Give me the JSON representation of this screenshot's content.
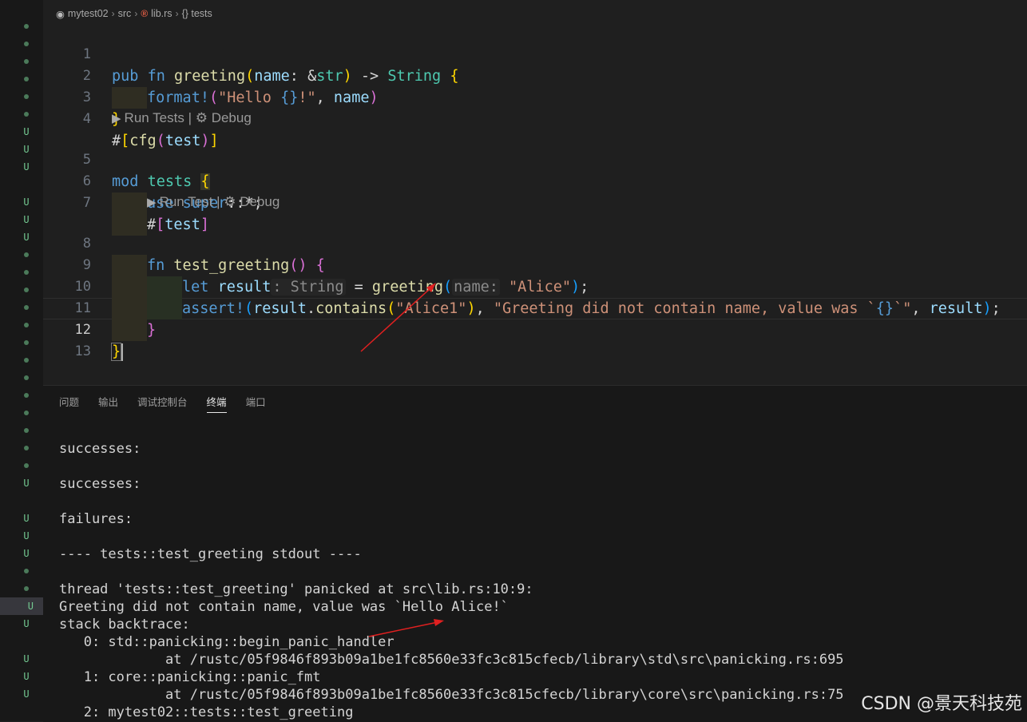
{
  "breadcrumb": {
    "project": "mytest02",
    "folder": "src",
    "file": "lib.rs",
    "symbol": "{} tests"
  },
  "code_lines": {
    "n1": "1",
    "n2": "2",
    "n3": "3",
    "n4": "4",
    "n5": "5",
    "n6": "6",
    "n7": "7",
    "n8": "8",
    "n9": "9",
    "n10": "10",
    "n11": "11",
    "n12": "12",
    "n13": "13"
  },
  "code_lens": {
    "run_tests": "Run Tests",
    "run_test": "Run Test",
    "separator": "|",
    "debug": "Debug"
  },
  "panel": {
    "tabs": [
      "问题",
      "输出",
      "调试控制台",
      "终端",
      "端口"
    ],
    "active_tab": "终端"
  },
  "terminal": {
    "lines": [
      "successes:",
      "",
      "successes:",
      "",
      "failures:",
      "",
      "---- tests::test_greeting stdout ----",
      "",
      "thread 'tests::test_greeting' panicked at src\\lib.rs:10:9:",
      "Greeting did not contain name, value was `Hello Alice!`",
      "stack backtrace:",
      "   0: std::panicking::begin_panic_handler",
      "             at /rustc/05f9846f893b09a1be1fc8560e33fc3c815cfecb/library\\std\\src\\panicking.rs:695",
      "   1: core::panicking::panic_fmt",
      "             at /rustc/05f9846f893b09a1be1fc8560e33fc3c815cfecb/library\\core\\src\\panicking.rs:75",
      "   2: mytest02::tests::test_greeting"
    ]
  },
  "watermark": "CSDN @景天科技苑",
  "colors": {
    "keyword": "#569cd6",
    "function": "#dcdcaa",
    "type": "#4ec9b0",
    "string": "#ce9178",
    "annotation_arrow": "#e02020"
  }
}
